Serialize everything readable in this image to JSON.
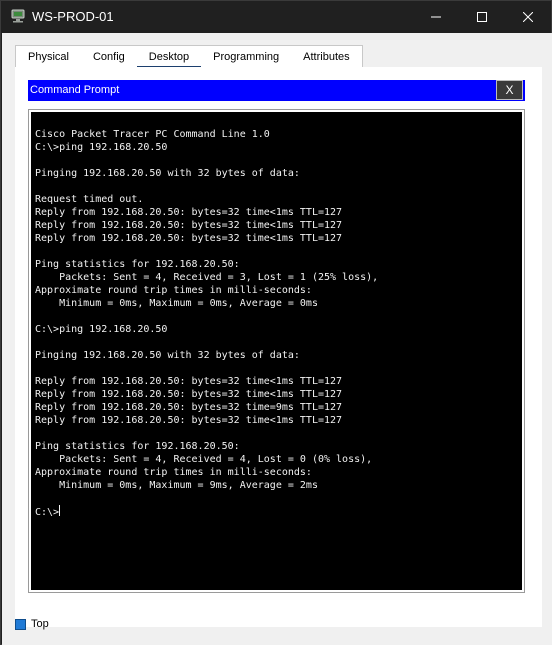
{
  "window": {
    "title": "WS-PROD-01",
    "icon": "packet-tracer-pc-icon"
  },
  "tabs": [
    {
      "label": "Physical",
      "active": false
    },
    {
      "label": "Config",
      "active": false
    },
    {
      "label": "Desktop",
      "active": true
    },
    {
      "label": "Programming",
      "active": false
    },
    {
      "label": "Attributes",
      "active": false
    }
  ],
  "command_prompt": {
    "title": "Command Prompt",
    "close_label": "X",
    "header_color": "#0000ff",
    "lines": [
      "Cisco Packet Tracer PC Command Line 1.0",
      "C:\\>ping 192.168.20.50",
      "",
      "Pinging 192.168.20.50 with 32 bytes of data:",
      "",
      "Request timed out.",
      "Reply from 192.168.20.50: bytes=32 time<1ms TTL=127",
      "Reply from 192.168.20.50: bytes=32 time<1ms TTL=127",
      "Reply from 192.168.20.50: bytes=32 time<1ms TTL=127",
      "",
      "Ping statistics for 192.168.20.50:",
      "    Packets: Sent = 4, Received = 3, Lost = 1 (25% loss),",
      "Approximate round trip times in milli-seconds:",
      "    Minimum = 0ms, Maximum = 0ms, Average = 0ms",
      "",
      "C:\\>ping 192.168.20.50",
      "",
      "Pinging 192.168.20.50 with 32 bytes of data:",
      "",
      "Reply from 192.168.20.50: bytes=32 time<1ms TTL=127",
      "Reply from 192.168.20.50: bytes=32 time<1ms TTL=127",
      "Reply from 192.168.20.50: bytes=32 time=9ms TTL=127",
      "Reply from 192.168.20.50: bytes=32 time<1ms TTL=127",
      "",
      "Ping statistics for 192.168.20.50:",
      "    Packets: Sent = 4, Received = 4, Lost = 0 (0% loss),",
      "Approximate round trip times in milli-seconds:",
      "    Minimum = 0ms, Maximum = 9ms, Average = 2ms",
      "",
      "C:\\>"
    ]
  },
  "footer": {
    "top_label": "Top",
    "top_checked": true
  }
}
